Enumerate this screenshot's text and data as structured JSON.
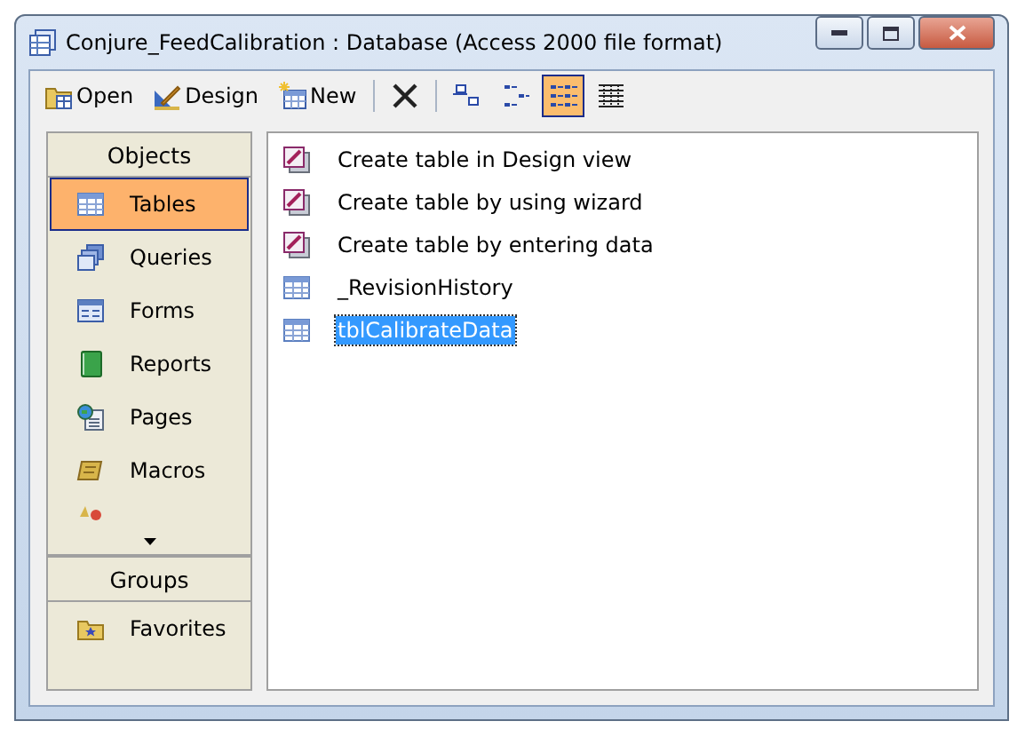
{
  "window": {
    "title": "Conjure_FeedCalibration : Database (Access 2000 file format)"
  },
  "toolbar": [
    {
      "kind": "text",
      "label": "Open",
      "selected": false
    },
    {
      "kind": "text",
      "label": "Design",
      "selected": false
    },
    {
      "kind": "text",
      "label": "New",
      "selected": false
    },
    {
      "kind": "separator"
    },
    {
      "kind": "icon",
      "selected": false
    },
    {
      "kind": "separator"
    },
    {
      "kind": "icon",
      "selected": false
    },
    {
      "kind": "icon",
      "selected": false
    },
    {
      "kind": "icon",
      "selected": true
    },
    {
      "kind": "icon",
      "selected": false
    }
  ],
  "sidebar": {
    "objects_header": "Objects",
    "objects": [
      {
        "label": "Tables",
        "selected": true
      },
      {
        "label": "Queries",
        "selected": false
      },
      {
        "label": "Forms",
        "selected": false
      },
      {
        "label": "Reports",
        "selected": false
      },
      {
        "label": "Pages",
        "selected": false
      },
      {
        "label": "Macros",
        "selected": false
      }
    ],
    "groups_header": "Groups",
    "groups": [
      {
        "label": "Favorites",
        "selected": false
      }
    ]
  },
  "list": [
    {
      "kind": "wizard",
      "label": "Create table in Design view",
      "selected": false
    },
    {
      "kind": "wizard",
      "label": "Create table by using wizard",
      "selected": false
    },
    {
      "kind": "wizard",
      "label": "Create table by entering data",
      "selected": false
    },
    {
      "kind": "table",
      "label": "_RevisionHistory",
      "selected": false
    },
    {
      "kind": "table",
      "label": "tblCalibrateData",
      "selected": true
    }
  ]
}
